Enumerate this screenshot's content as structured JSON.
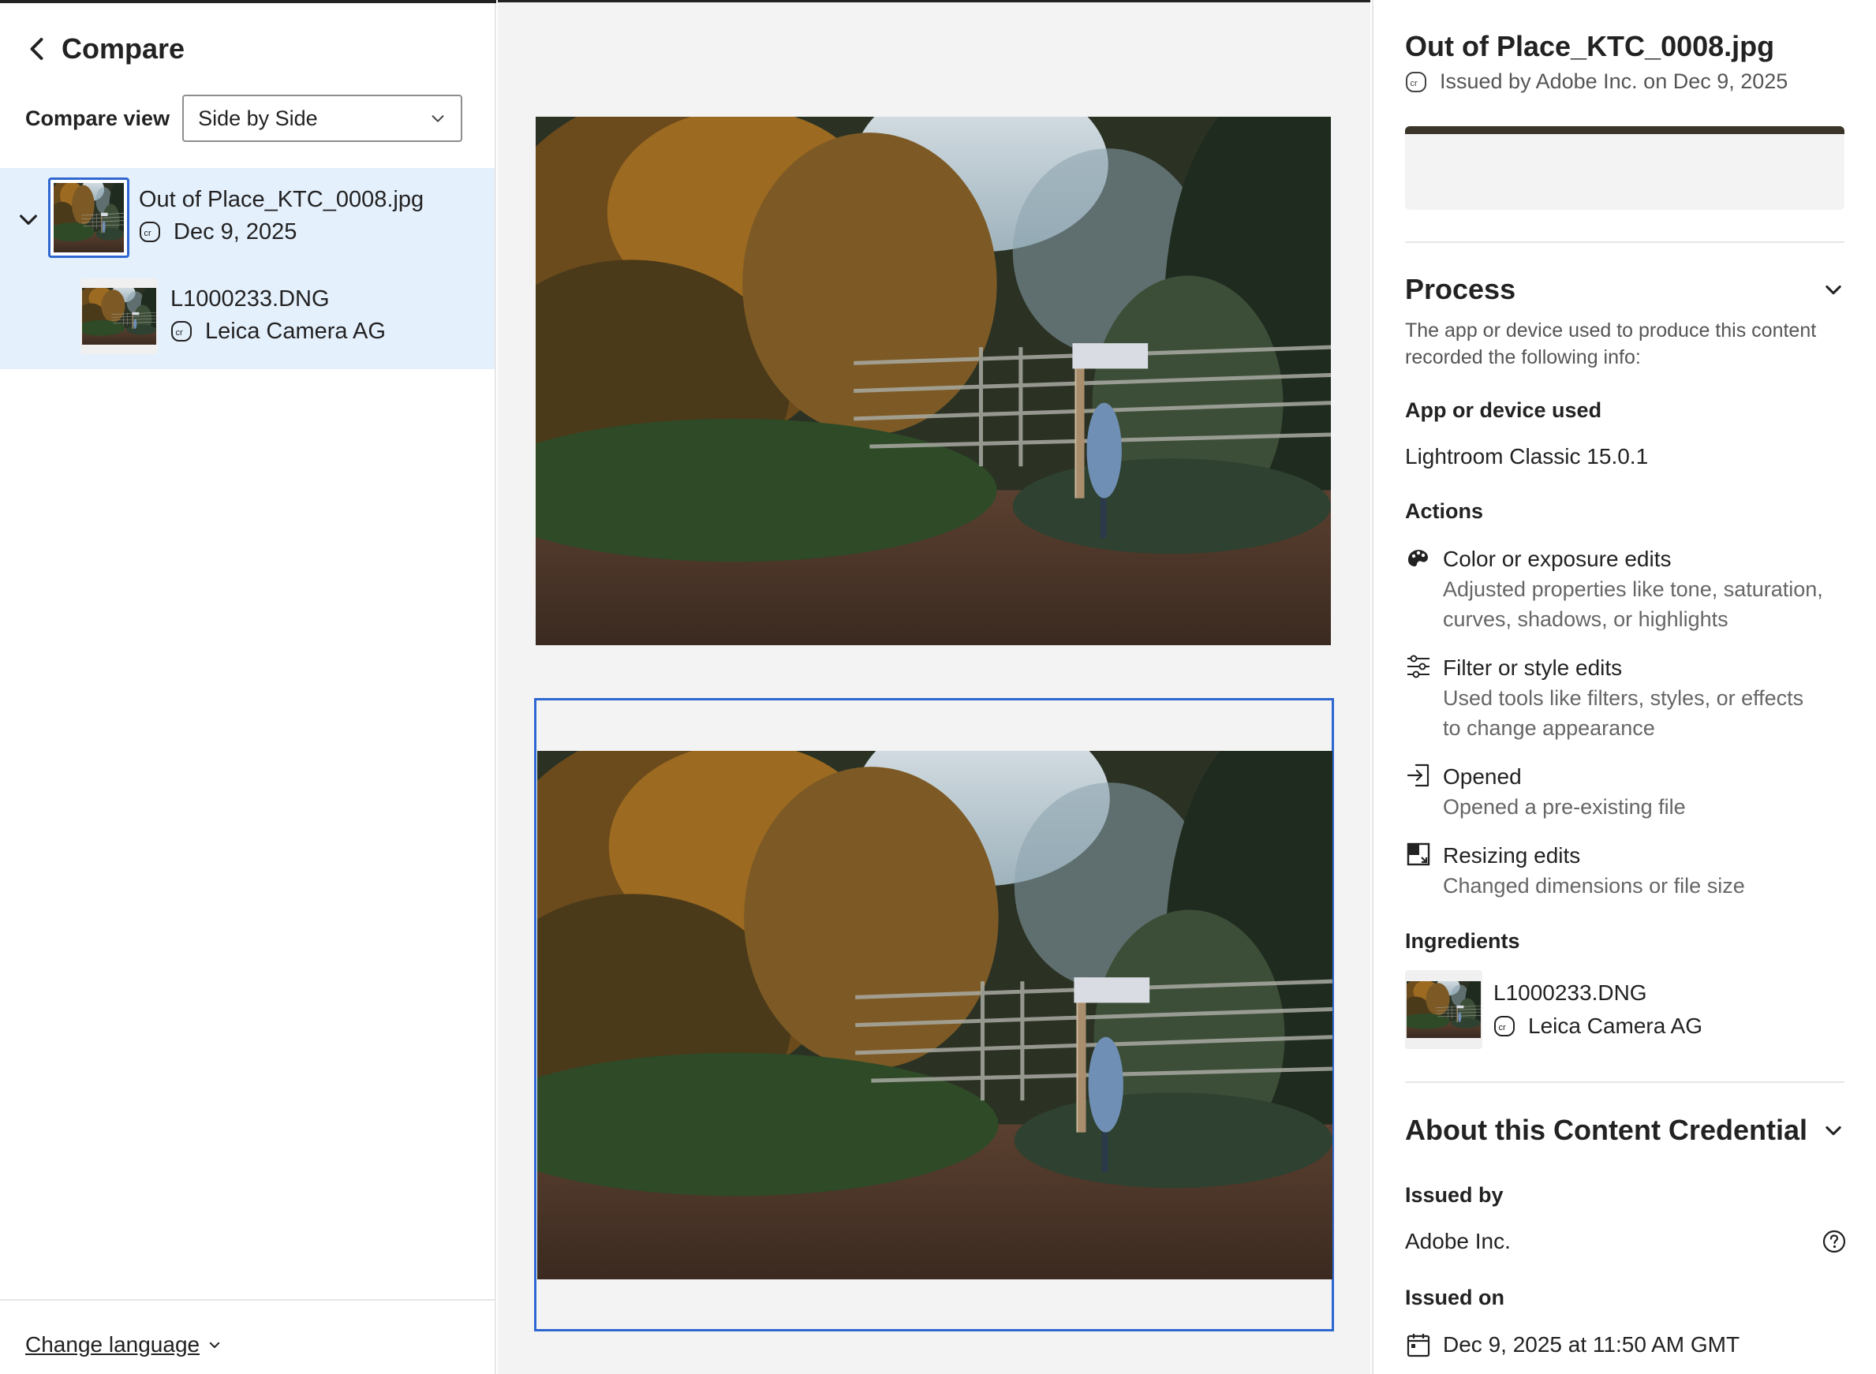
{
  "sidebar": {
    "title": "Compare",
    "compare_view_label": "Compare view",
    "compare_view_value": "Side by Side",
    "items": [
      {
        "name": "Out of Place_KTC_0008.jpg",
        "sub": "Dec 9, 2025",
        "selected": true
      },
      {
        "name": "L1000233.DNG",
        "sub": "Leica Camera AG",
        "selected": false
      }
    ],
    "footer_link": "Change language"
  },
  "details": {
    "file_title": "Out of Place_KTC_0008.jpg",
    "issued_line": "Issued by Adobe Inc. on Dec 9, 2025",
    "process": {
      "heading": "Process",
      "description": "The app or device used to produce this content recorded the following info:",
      "app_label": "App or device used",
      "app_value": "Lightroom Classic 15.0.1",
      "actions_label": "Actions",
      "actions": [
        {
          "icon": "palette-icon",
          "title": "Color or exposure edits",
          "desc1": "Adjusted properties like tone, saturation,",
          "desc2": "curves, shadows, or highlights"
        },
        {
          "icon": "sliders-icon",
          "title": "Filter or style edits",
          "desc1": "Used tools like filters, styles, or effects",
          "desc2": "to change appearance"
        },
        {
          "icon": "import-icon",
          "title": "Opened",
          "desc1": "Opened a pre-existing file"
        },
        {
          "icon": "resize-icon",
          "title": "Resizing edits",
          "desc1": "Changed dimensions or file size"
        }
      ],
      "ingredients_label": "Ingredients",
      "ingredient": {
        "name": "L1000233.DNG",
        "sub": "Leica Camera AG"
      }
    },
    "about": {
      "heading": "About this Content Credential",
      "issued_by_label": "Issued by",
      "issued_by_value": "Adobe Inc.",
      "issued_on_label": "Issued on",
      "issued_on_value": "Dec 9, 2025 at 11:50 AM GMT"
    }
  },
  "colors": {
    "accent": "#2f67d0",
    "selected_bg": "#e5f0fd",
    "canvas_bg": "#f3f3f3"
  }
}
